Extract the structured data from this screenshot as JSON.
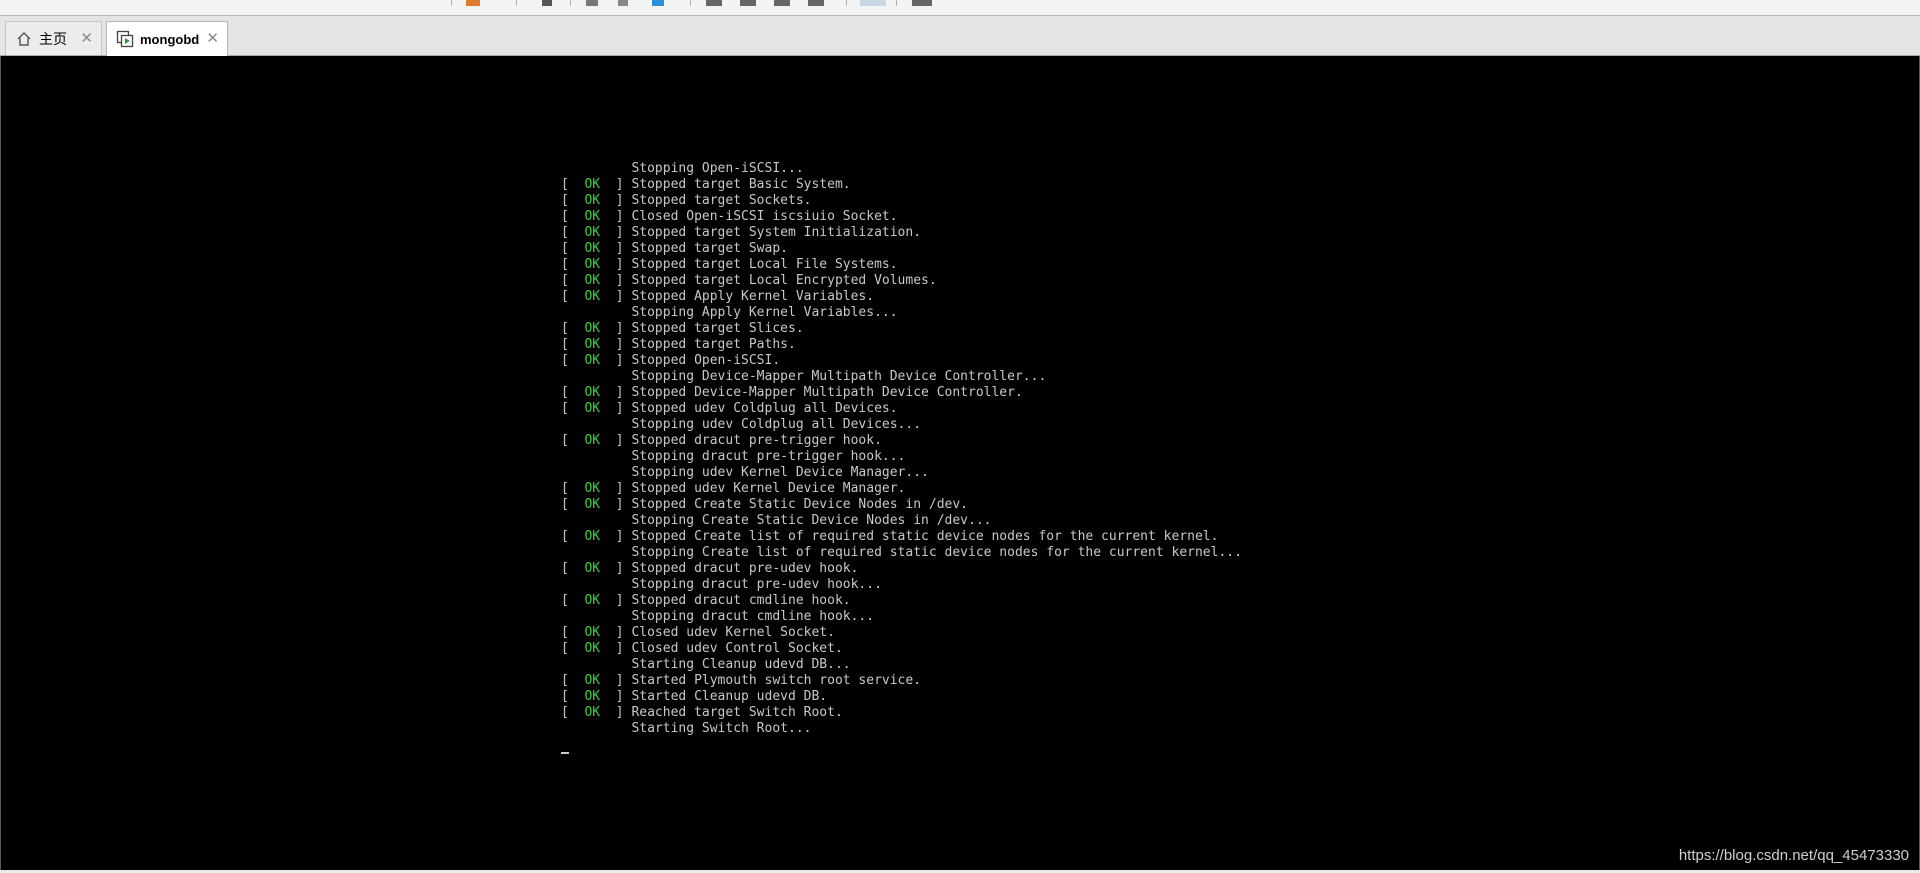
{
  "tabs": [
    {
      "label": "主页",
      "icon": "home-icon",
      "active": false
    },
    {
      "label": "mongobd",
      "icon": "vm-icon",
      "active": true
    }
  ],
  "console": {
    "lines": [
      {
        "status": "",
        "text": "Stopping Open-iSCSI..."
      },
      {
        "status": "OK",
        "text": "Stopped target Basic System."
      },
      {
        "status": "OK",
        "text": "Stopped target Sockets."
      },
      {
        "status": "OK",
        "text": "Closed Open-iSCSI iscsiuio Socket."
      },
      {
        "status": "OK",
        "text": "Stopped target System Initialization."
      },
      {
        "status": "OK",
        "text": "Stopped target Swap."
      },
      {
        "status": "OK",
        "text": "Stopped target Local File Systems."
      },
      {
        "status": "OK",
        "text": "Stopped target Local Encrypted Volumes."
      },
      {
        "status": "OK",
        "text": "Stopped Apply Kernel Variables."
      },
      {
        "status": "",
        "text": "Stopping Apply Kernel Variables..."
      },
      {
        "status": "OK",
        "text": "Stopped target Slices."
      },
      {
        "status": "OK",
        "text": "Stopped target Paths."
      },
      {
        "status": "OK",
        "text": "Stopped Open-iSCSI."
      },
      {
        "status": "",
        "text": "Stopping Device-Mapper Multipath Device Controller..."
      },
      {
        "status": "OK",
        "text": "Stopped Device-Mapper Multipath Device Controller."
      },
      {
        "status": "OK",
        "text": "Stopped udev Coldplug all Devices."
      },
      {
        "status": "",
        "text": "Stopping udev Coldplug all Devices..."
      },
      {
        "status": "OK",
        "text": "Stopped dracut pre-trigger hook."
      },
      {
        "status": "",
        "text": "Stopping dracut pre-trigger hook..."
      },
      {
        "status": "",
        "text": "Stopping udev Kernel Device Manager..."
      },
      {
        "status": "OK",
        "text": "Stopped udev Kernel Device Manager."
      },
      {
        "status": "OK",
        "text": "Stopped Create Static Device Nodes in /dev."
      },
      {
        "status": "",
        "text": "Stopping Create Static Device Nodes in /dev..."
      },
      {
        "status": "OK",
        "text": "Stopped Create list of required static device nodes for the current kernel."
      },
      {
        "status": "",
        "text": "Stopping Create list of required static device nodes for the current kernel..."
      },
      {
        "status": "OK",
        "text": "Stopped dracut pre-udev hook."
      },
      {
        "status": "",
        "text": "Stopping dracut pre-udev hook..."
      },
      {
        "status": "OK",
        "text": "Stopped dracut cmdline hook."
      },
      {
        "status": "",
        "text": "Stopping dracut cmdline hook..."
      },
      {
        "status": "OK",
        "text": "Closed udev Kernel Socket."
      },
      {
        "status": "OK",
        "text": "Closed udev Control Socket."
      },
      {
        "status": "",
        "text": "Starting Cleanup udevd DB..."
      },
      {
        "status": "OK",
        "text": "Started Plymouth switch root service."
      },
      {
        "status": "OK",
        "text": "Started Cleanup udevd DB."
      },
      {
        "status": "OK",
        "text": "Reached target Switch Root."
      },
      {
        "status": "",
        "text": "Starting Switch Root..."
      }
    ]
  },
  "watermark": "https://blog.csdn.net/qq_45473330",
  "colors": {
    "ok": "#3bd13b",
    "console_text": "#c8c8c8",
    "console_bg": "#000000"
  }
}
